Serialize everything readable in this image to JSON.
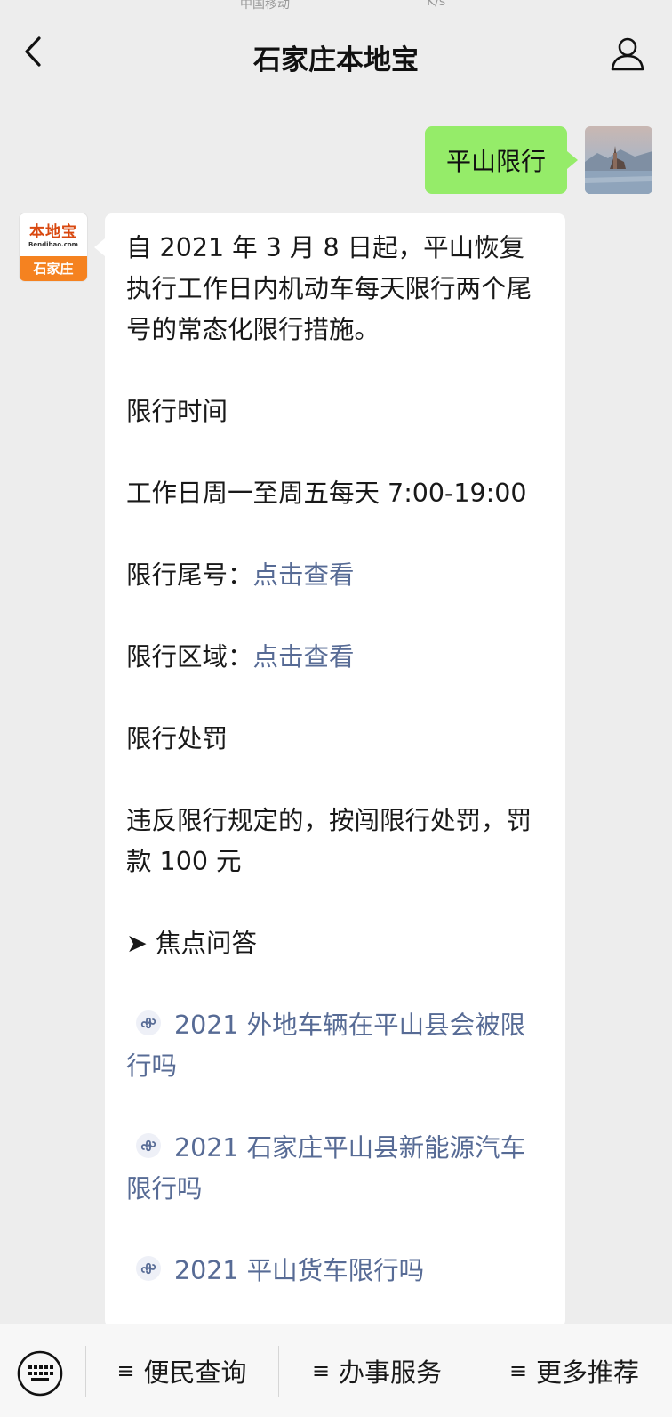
{
  "status_bar": {
    "carrier": "中国移动",
    "speed": "K/s"
  },
  "nav": {
    "title": "石家庄本地宝"
  },
  "outgoing_message": {
    "text": "平山限行"
  },
  "account_avatar": {
    "logo_text": "本地宝",
    "logo_domain": "Bendibao.com",
    "logo_city": "石家庄"
  },
  "incoming_message": {
    "intro": "自 2021 年 3 月 8 日起，平山恢复执行工作日内机动车每天限行两个尾号的常态化限行措施。",
    "time_heading": "限行时间",
    "time_text": "工作日周一至周五每天 7:00-19:00",
    "tail_label": "限行尾号：",
    "tail_link": "点击查看",
    "area_label": "限行区域：",
    "area_link": "点击查看",
    "penalty_heading": "限行处罚",
    "penalty_text": "违反限行规定的，按闯限行处罚，罚款 100 元",
    "faq_heading": "➤ 焦点问答",
    "faq_links": [
      "2021 外地车辆在平山县会被限行吗",
      "2021 石家庄平山县新能源汽车限行吗",
      "2021 平山货车限行吗"
    ]
  },
  "bottom_menu": {
    "items": [
      "便民查询",
      "办事服务",
      "更多推荐"
    ],
    "menu_icon": "≡"
  },
  "colors": {
    "page_bg": "#ededed",
    "outgoing_bubble": "#95ec69",
    "incoming_bubble": "#ffffff",
    "link": "#576b95",
    "logo_orange": "#f58220"
  },
  "icons": {
    "back": "chevron-left-icon",
    "profile": "person-icon",
    "keyboard": "keyboard-icon",
    "mini_program": "mini-program-icon"
  }
}
